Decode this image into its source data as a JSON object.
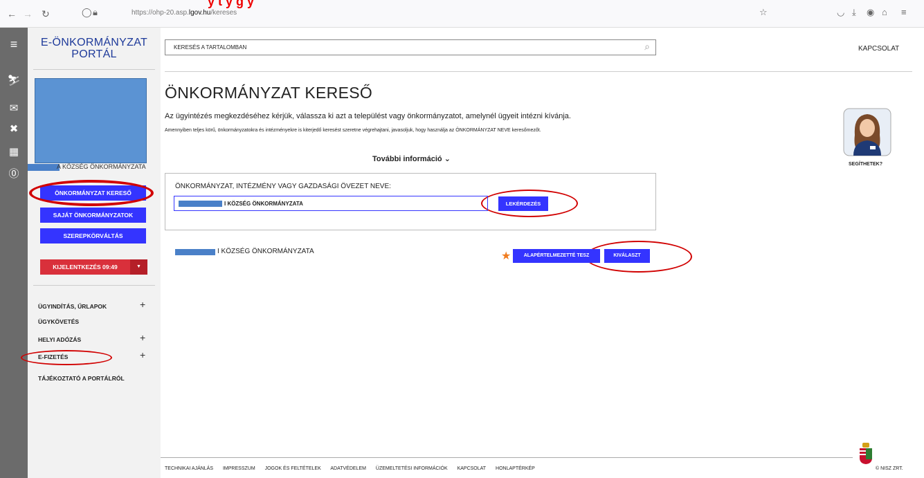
{
  "browser": {
    "overlay_text": "y                                  t    y        g             y",
    "url_prefix": "https://ohp-20.asp.",
    "url_host": "lgov.hu",
    "url_suffix": "/kereses"
  },
  "header": {
    "logo_line1": "E-ÖNKORMÁNYZAT",
    "logo_line2": "PORTÁL",
    "search_placeholder": "KERESÉS A TARTALOMBAN",
    "contact": "KAPCSOLAT"
  },
  "sidebar": {
    "municipality": "A KÖZSÉG ÖNKORMÁNYZATA",
    "buttons": [
      "ÖNKORMÁNYZAT KERESŐ",
      "SAJÁT ÖNKORMÁNYZATOK",
      "SZEREPKÖRVÁLTÁS"
    ],
    "logout_label": "KIJELENTKEZÉS 09:49",
    "menu": [
      {
        "label": "ÜGYINDÍTÁS, ŰRLAPOK",
        "expandable": true
      },
      {
        "label": "ÜGYKÖVETÉS",
        "expandable": false
      },
      {
        "label": "HELYI ADÓZÁS",
        "expandable": true
      },
      {
        "label": "E-FIZETÉS",
        "expandable": true
      },
      {
        "label": "TÁJÉKOZTATÓ A PORTÁLRÓL",
        "expandable": false
      }
    ]
  },
  "main": {
    "title": "ÖNKORMÁNYZAT KERESŐ",
    "intro": "Az ügyintézés megkezdéséhez kérjük, válassza ki azt a települést vagy önkormányzatot, amelynél ügyeit intézni kívánja.",
    "note": "Amennyiben teljes körű, önkormányzatokra és intézményekre is kiterjedő keresést szeretne végrehajtani, javasoljuk, hogy használja az ÖNKORMÁNYZAT NEVE keresőmezőt.",
    "more_info": "További információ",
    "field_label": "ÖNKORMÁNYZAT, INTÉZMÉNY VAGY GAZDASÁGI ÖVEZET NEVE:",
    "field_value": "I KÖZSÉG ÖNKORMÁNYZATA",
    "query_button": "LEKÉRDEZÉS",
    "result_name": "I KÖZSÉG ÖNKORMÁNYZATA",
    "default_button": "ALAPÉRTELMEZETTÉ TESZ",
    "select_button": "KIVÁLASZT"
  },
  "helper": {
    "label": "SEGÍTHETEK?"
  },
  "footer": {
    "links": [
      "TECHNIKAI AJÁNLÁS",
      "IMPRESSZUM",
      "JOGOK ÉS FELTÉTELEK",
      "ADATVÉDELEM",
      "ÜZEMELTETÉSI INFORMÁCIÓK",
      "KAPCSOLAT",
      "HONLAPTÉRKÉP"
    ],
    "copyright": "© NISZ ZRT."
  },
  "colors": {
    "primary_button": "#3434ff",
    "logout": "#d9303b",
    "annotation": "#d10000",
    "star": "#f07c1f"
  }
}
